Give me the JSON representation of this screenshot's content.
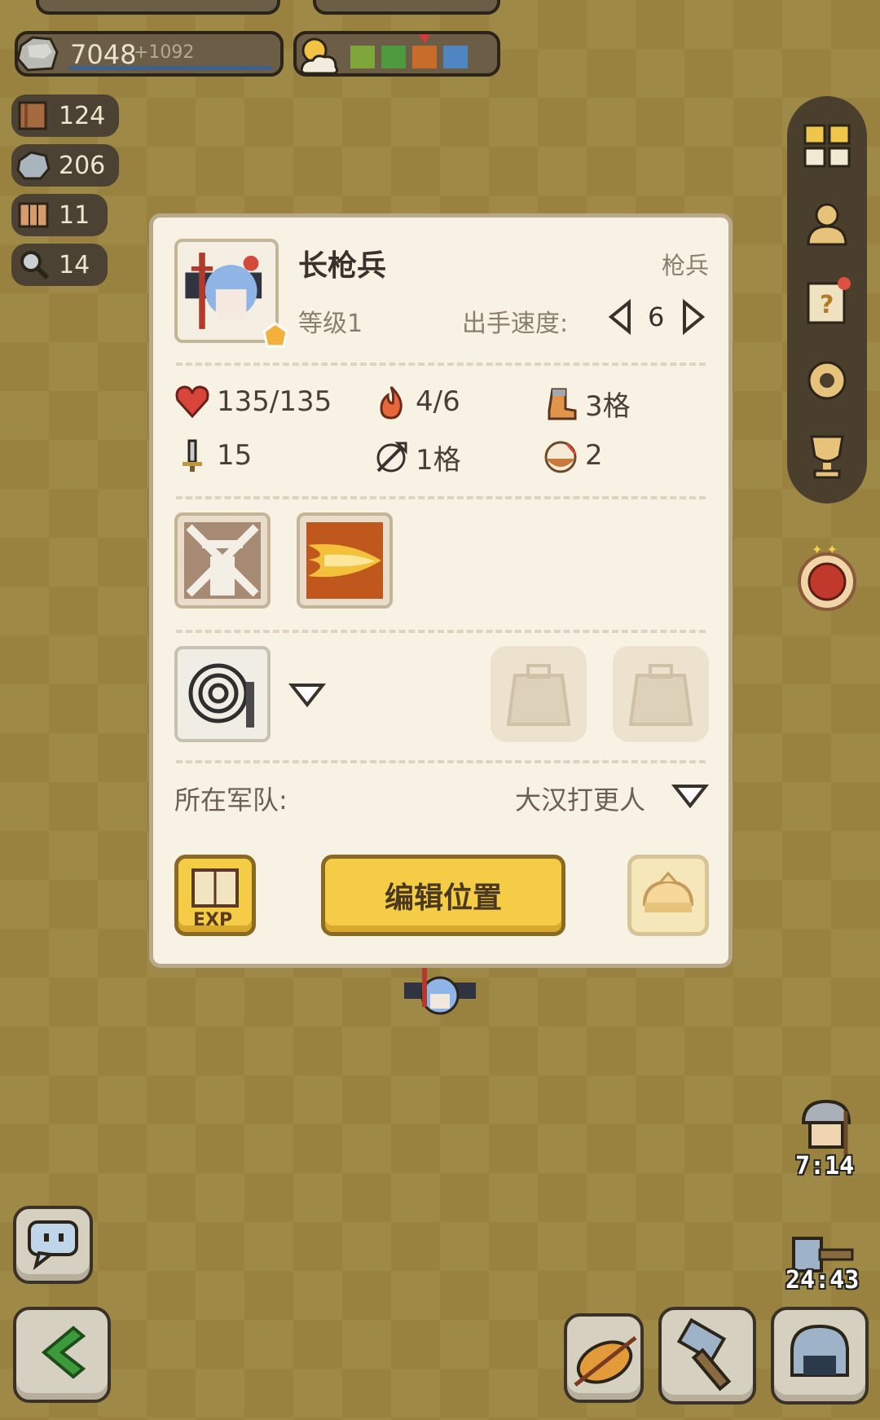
{
  "resources": {
    "stone": {
      "value": "7048",
      "delta": "+1092"
    },
    "weather_colors": [
      "#7ea63a",
      "#4f9a3e",
      "#c86c2c",
      "#4f86c2"
    ]
  },
  "side_counters": [
    {
      "icon": "book-icon",
      "value": "124"
    },
    {
      "icon": "ore-icon",
      "value": "206"
    },
    {
      "icon": "map-icon",
      "value": "11"
    },
    {
      "icon": "magnifier-icon",
      "value": "14"
    }
  ],
  "unit": {
    "name": "长枪兵",
    "class": "枪兵",
    "level": "等级1",
    "speed_label": "出手速度:",
    "speed_value": "6"
  },
  "stats": {
    "hp": "135/135",
    "fire": "4/6",
    "move": "3格",
    "attack": "15",
    "range": "1格",
    "food": "2"
  },
  "army": {
    "label": "所在军队:",
    "value": "大汉打更人"
  },
  "buttons": {
    "edit": "编辑位置"
  },
  "timers": [
    "7:14",
    "24:43"
  ],
  "colors": {
    "panel": "#f7f2e3",
    "accent_button": "#f4cc45",
    "board": "#cfb65f"
  }
}
